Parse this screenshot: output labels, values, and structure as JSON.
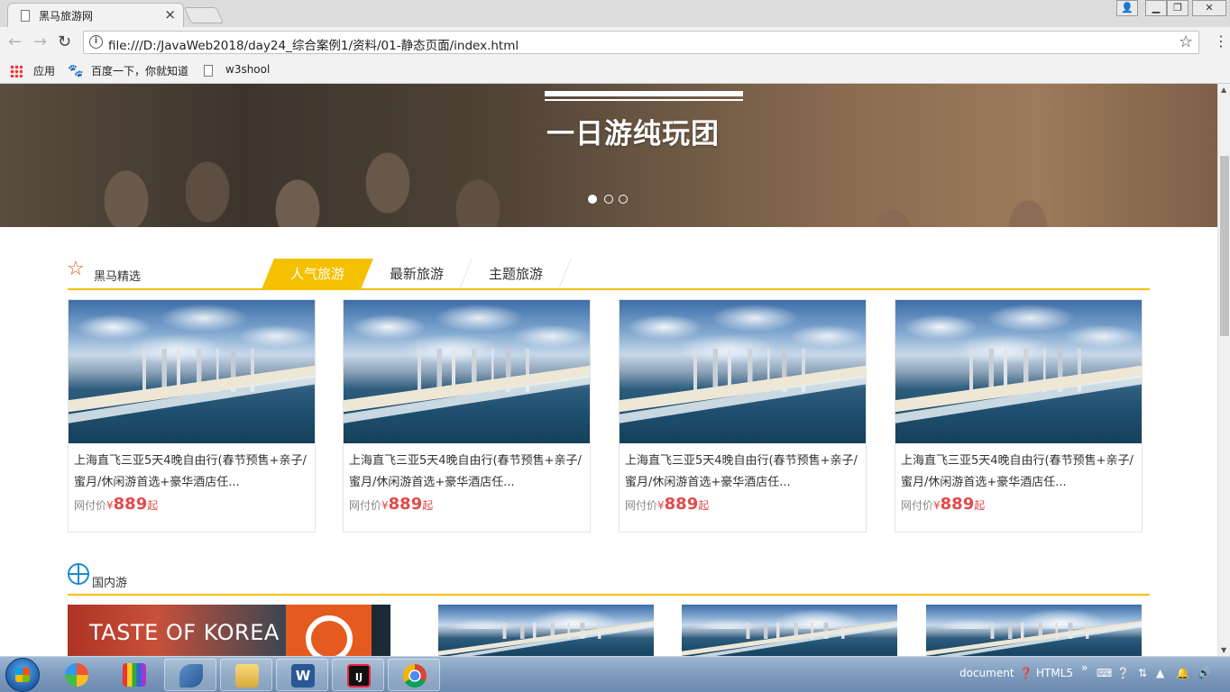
{
  "browser": {
    "tab_title": "黑马旅游网",
    "tab_close": "×",
    "url": "file:///D:/JavaWeb2018/day24_综合案例1/资料/01-静态页面/index.html",
    "info_glyph": "i",
    "back_glyph": "←",
    "forward_glyph": "→",
    "reload_glyph": "↻",
    "star_glyph": "☆",
    "menu_glyph": "⋮",
    "win_user": "👤",
    "win_min": "▁",
    "win_max": "❐",
    "win_close": "✕",
    "bookmarks": [
      {
        "label": "应用"
      },
      {
        "label": "百度一下，你就知道"
      },
      {
        "label": "w3shool"
      }
    ]
  },
  "banner": {
    "caption": "一日游纯玩团",
    "slide_count": 3,
    "active_slide": 1
  },
  "featured": {
    "title": "黑马精选",
    "tabs": [
      "人气旅游",
      "最新旅游",
      "主题旅游"
    ],
    "active_tab": 0,
    "cards": [
      {
        "name": "上海直飞三亚5天4晚自由行(春节预售+亲子/蜜月/休闲游首选+豪华酒店任...",
        "price_label": "网付价",
        "currency": "¥",
        "price": "889",
        "suffix": "起"
      },
      {
        "name": "上海直飞三亚5天4晚自由行(春节预售+亲子/蜜月/休闲游首选+豪华酒店任...",
        "price_label": "网付价",
        "currency": "¥",
        "price": "889",
        "suffix": "起"
      },
      {
        "name": "上海直飞三亚5天4晚自由行(春节预售+亲子/蜜月/休闲游首选+豪华酒店任...",
        "price_label": "网付价",
        "currency": "¥",
        "price": "889",
        "suffix": "起"
      },
      {
        "name": "上海直飞三亚5天4晚自由行(春节预售+亲子/蜜月/休闲游首选+豪华酒店任...",
        "price_label": "网付价",
        "currency": "¥",
        "price": "889",
        "suffix": "起"
      }
    ]
  },
  "domestic": {
    "title": "国内游",
    "promo_text": "TASTE OF KOREA"
  },
  "taskbar": {
    "apps": [
      "windows-start",
      "picasa",
      "paint",
      "mysql-workbench",
      "file-explorer",
      "word",
      "intellij-idea",
      "chrome"
    ],
    "tray_document": "document",
    "tray_html5": "HTML5",
    "tray_more": "»"
  }
}
